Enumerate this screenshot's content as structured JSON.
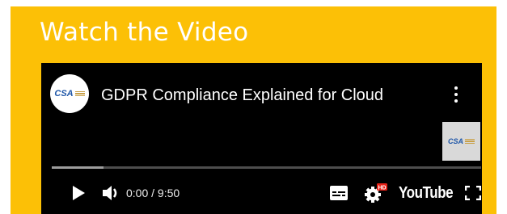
{
  "section": {
    "title": "Watch the Video"
  },
  "player": {
    "channel_logo_text": "CSA",
    "video_title": "GDPR Compliance Explained for Cloud",
    "watermark_text": "CSA",
    "time_display": "0:00 / 9:50",
    "buffered_fraction": 0.12,
    "played_fraction": 0.0,
    "settings_badge": "HD",
    "brand": "YouTube",
    "icons": [
      "menu-icon",
      "play-icon",
      "volume-icon",
      "captions-icon",
      "settings-icon",
      "fullscreen-icon"
    ]
  },
  "colors": {
    "panel": "#fcc006",
    "player_bg": "#000000",
    "hd_badge": "#e62117",
    "logo_blue": "#1e56a8"
  }
}
